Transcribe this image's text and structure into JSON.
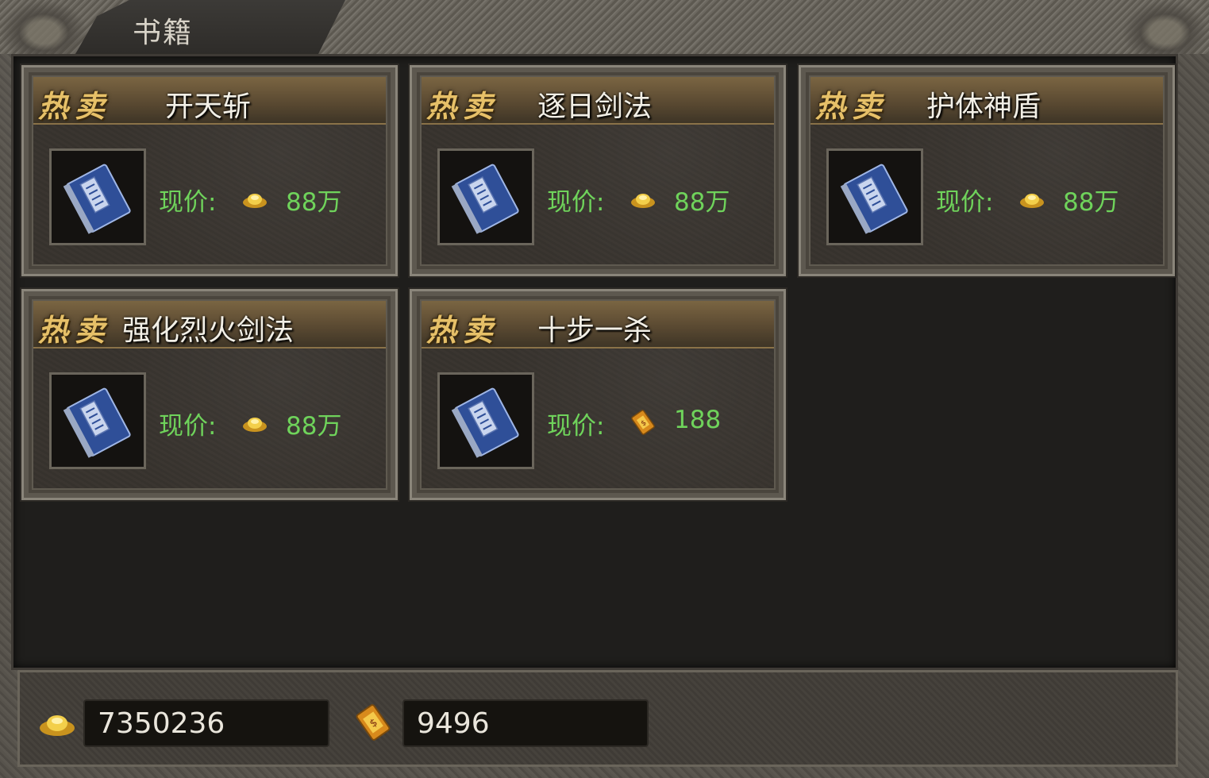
{
  "panel": {
    "title": "书籍"
  },
  "card_common": {
    "hot_label": "热卖",
    "price_label": "现价:"
  },
  "items": [
    {
      "name": "开天斩",
      "price": "88万",
      "currency": "gold-ingot-icon"
    },
    {
      "name": "逐日剑法",
      "price": "88万",
      "currency": "gold-ingot-icon"
    },
    {
      "name": "护体神盾",
      "price": "88万",
      "currency": "gold-ingot-icon"
    },
    {
      "name": "强化烈火剑法",
      "price": "88万",
      "currency": "gold-ingot-icon"
    },
    {
      "name": "十步一杀",
      "price": "188",
      "currency": "gold-ticket-icon"
    }
  ],
  "balances": {
    "gold_ingot": "7350236",
    "gold_ticket": "9496"
  },
  "colors": {
    "price_green": "#6fd35b",
    "hot_gold": "#e6c068",
    "book_blue": "#3b5fb0"
  }
}
